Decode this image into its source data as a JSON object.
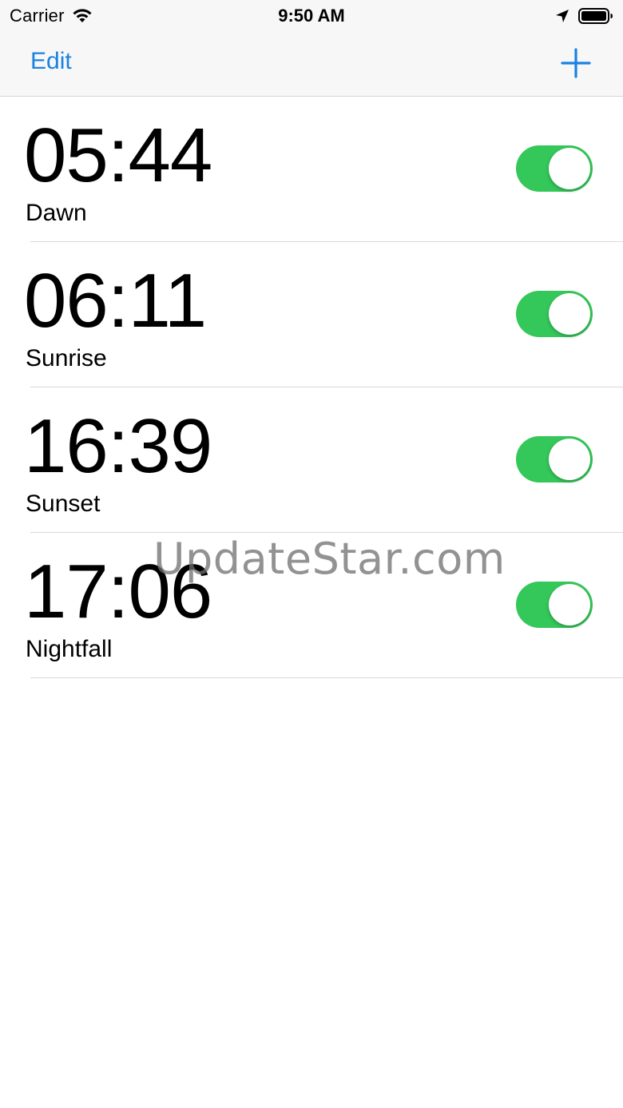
{
  "status_bar": {
    "carrier": "Carrier",
    "time": "9:50 AM",
    "icons": [
      "wifi-icon",
      "location-arrow-icon",
      "battery-icon"
    ]
  },
  "nav_bar": {
    "edit_label": "Edit",
    "add_icon": "plus-icon",
    "accent_color": "#1a82e2"
  },
  "alarms": [
    {
      "time": "05:44",
      "label": "Dawn",
      "enabled": true
    },
    {
      "time": "06:11",
      "label": "Sunrise",
      "enabled": true
    },
    {
      "time": "16:39",
      "label": "Sunset",
      "enabled": true
    },
    {
      "time": "17:06",
      "label": "Nightfall",
      "enabled": true
    }
  ],
  "colors": {
    "toggle_on": "#34c759",
    "separator": "#d8d8da",
    "bar_background": "#f7f7f7"
  },
  "watermark": "UpdateStar.com"
}
